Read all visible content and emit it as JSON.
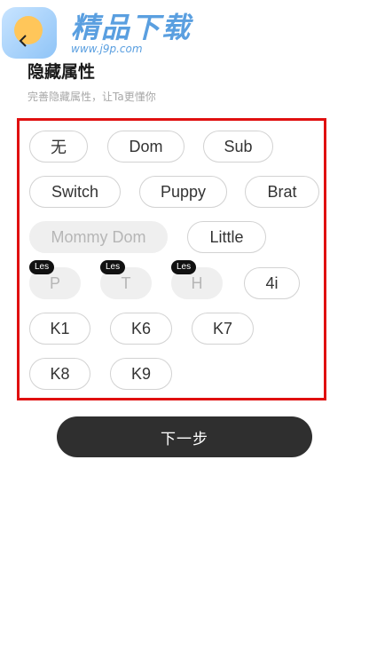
{
  "watermark": {
    "title": "精品下载",
    "url": "www.j9p.com"
  },
  "header": {
    "title": "隐藏属性",
    "subtitle": "完善隐藏属性，让Ta更懂你"
  },
  "tags": [
    {
      "label": "无"
    },
    {
      "label": "Dom"
    },
    {
      "label": "Sub"
    },
    {
      "label": "Switch"
    },
    {
      "label": "Puppy"
    },
    {
      "label": "Brat"
    },
    {
      "label": "Mommy Dom",
      "state": "disabled"
    },
    {
      "label": "Little"
    },
    {
      "label": "P",
      "state": "disabled",
      "badge": "Les"
    },
    {
      "label": "T",
      "state": "disabled",
      "badge": "Les"
    },
    {
      "label": "H",
      "state": "disabled",
      "badge": "Les"
    },
    {
      "label": "4i"
    },
    {
      "label": "K1"
    },
    {
      "label": "K6"
    },
    {
      "label": "K7"
    },
    {
      "label": "K8"
    },
    {
      "label": "K9"
    }
  ],
  "actions": {
    "next_label": "下一步"
  },
  "colors": {
    "highlight": "#e01010",
    "button_bg": "#2f2f2f",
    "disabled_bg": "#efefef"
  }
}
